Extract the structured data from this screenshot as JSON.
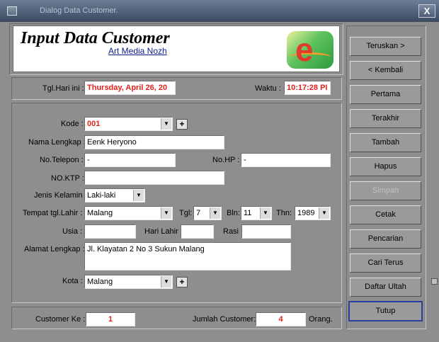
{
  "window": {
    "title": "Dialog Data Customer.",
    "close_label": "X"
  },
  "header": {
    "title": "Input Data Customer",
    "subtitle": "Art Media Nozh",
    "logo_letter": "e"
  },
  "datebar": {
    "date_label": "Tgl.Hari ini :",
    "date_value": "Thursday, April 26, 20",
    "time_label": "Waktu :",
    "time_value": "10:17:28 PI"
  },
  "form": {
    "kode_label": "Kode :",
    "kode_value": "001",
    "nama_label": "Nama Lengkap :",
    "nama_value": "Eenk Heryono",
    "telepon_label": "No.Telepon :",
    "telepon_value": "-",
    "hp_label": "No.HP :",
    "hp_value": "-",
    "ktp_label": "NO.KTP :",
    "ktp_value": "",
    "jk_label": "Jenis Kelamin :",
    "jk_value": "Laki-laki",
    "tempat_label": "Tempat tgl.Lahir :",
    "tempat_value": "Malang",
    "tgl_label": "Tgl:",
    "tgl_value": "7",
    "bln_label": "Bln:",
    "bln_value": "11",
    "thn_label": "Thn:",
    "thn_value": "1989",
    "usia_label": "Usia :",
    "usia_value": "",
    "harilahir_label": "Hari Lahir :",
    "harilahir_value": "",
    "rasi_label": "Rasi :",
    "rasi_value": "",
    "alamat_label": "Alamat Lengkap :",
    "alamat_value": "Jl. Klayatan 2 No 3 Sukun Malang",
    "kota_label": "Kota :",
    "kota_value": "Malang",
    "plus_label": "+"
  },
  "footer": {
    "customer_ke_label": "Customer Ke :",
    "customer_ke_value": "1",
    "jumlah_label": "Jumlah Customer:",
    "jumlah_value": "4",
    "orang_label": "Orang."
  },
  "buttons": {
    "teruskan": "Teruskan >",
    "kembali": "< Kembali",
    "pertama": "Pertama",
    "terakhir": "Terakhir",
    "tambah": "Tambah",
    "hapus": "Hapus",
    "simpan": "Simpan",
    "cetak": "Cetak",
    "pencarian": "Pencarian",
    "cari_terus": "Cari Terus",
    "daftar_ultah": "Daftar Ultah",
    "tutup": "Tutup"
  },
  "colors": {
    "accent_red": "#e32018",
    "link_blue": "#0a1b8c",
    "focus_border": "#2c3fa0"
  }
}
